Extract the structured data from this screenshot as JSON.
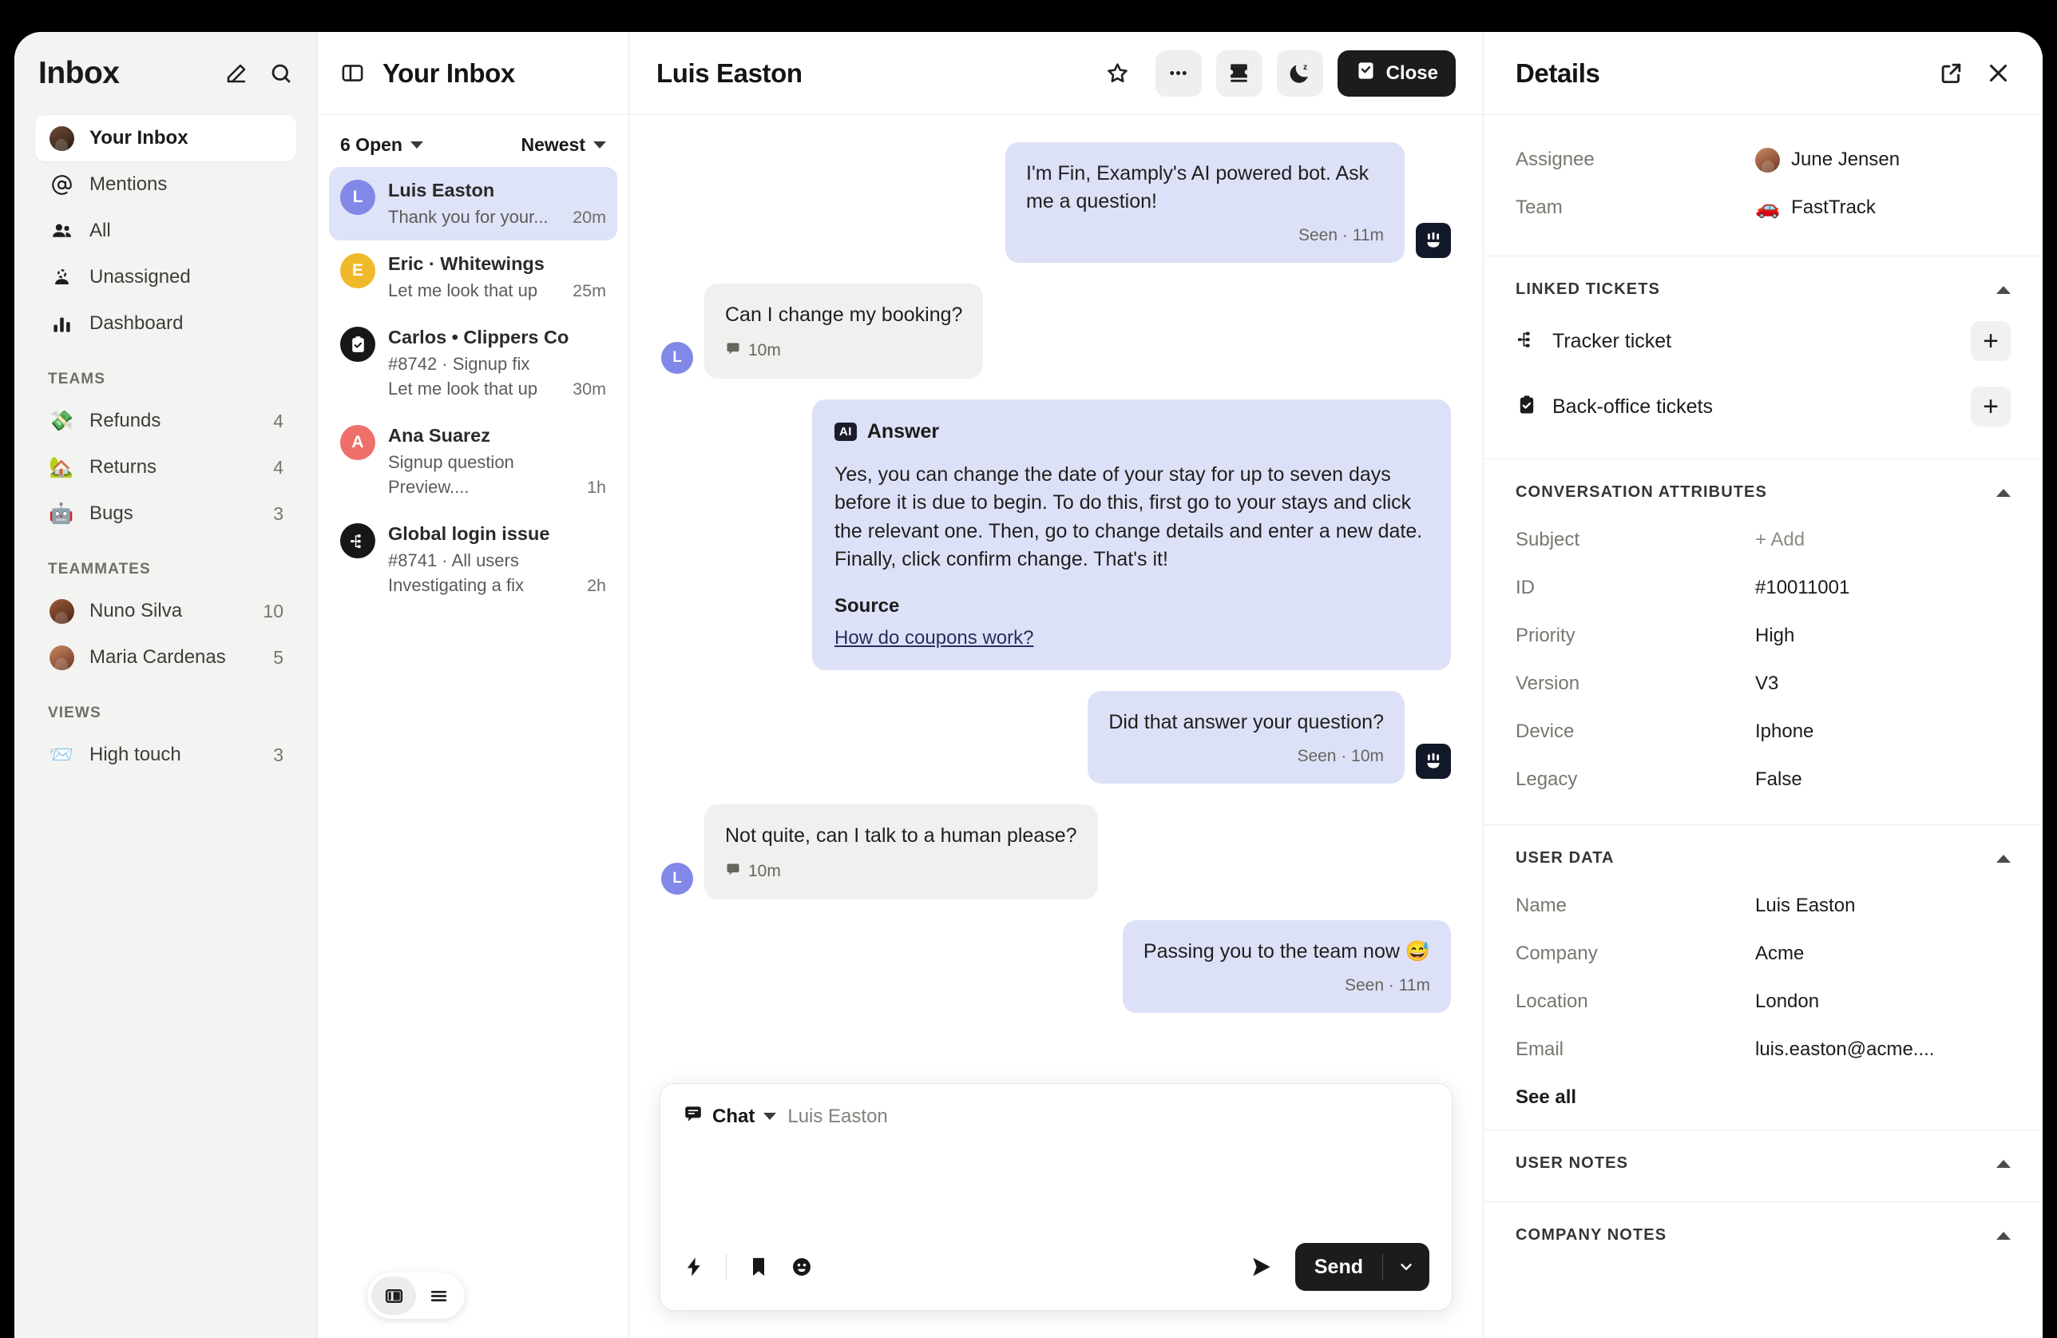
{
  "nav": {
    "title": "Inbox",
    "icons": {
      "compose": "compose-icon",
      "search": "search-icon"
    },
    "items": [
      {
        "label": "Your Inbox",
        "icon": "avatar",
        "active": true
      },
      {
        "label": "Mentions",
        "icon": "at-sign-icon"
      },
      {
        "label": "All",
        "icon": "people-icon"
      },
      {
        "label": "Unassigned",
        "icon": "unassigned-icon"
      },
      {
        "label": "Dashboard",
        "icon": "bar-chart-icon"
      }
    ],
    "teams_title": "TEAMS",
    "teams": [
      {
        "label": "Refunds",
        "emoji": "💸",
        "count": "4"
      },
      {
        "label": "Returns",
        "emoji": "🏡",
        "count": "4"
      },
      {
        "label": "Bugs",
        "emoji": "🤖",
        "count": "3"
      }
    ],
    "teammates_title": "TEAMMATES",
    "teammates": [
      {
        "label": "Nuno Silva",
        "count": "10"
      },
      {
        "label": "Maria Cardenas",
        "count": "5"
      }
    ],
    "views_title": "VIEWS",
    "views": [
      {
        "label": "High touch",
        "emoji": "📨",
        "count": "3"
      }
    ]
  },
  "conversation_list": {
    "header_title": "Your Inbox",
    "panel_icon": "panel-layout-icon",
    "filter": "6 Open",
    "sort": "Newest",
    "items": [
      {
        "name": "Luis Easton",
        "avatar_letter": "L",
        "avatar_color": "#8288e8",
        "meta": "",
        "preview": "Thank you for your...",
        "time": "20m",
        "selected": true
      },
      {
        "name": "Eric · Whitewings",
        "avatar_letter": "E",
        "avatar_color": "#f0b92a",
        "meta": "",
        "preview": "Let me look that up",
        "time": "25m",
        "selected": false
      },
      {
        "name": "Carlos • Clippers Co",
        "avatar_letter": "",
        "avatar_color": "#1c1c1a",
        "avatar_icon": "clipboard-check-icon",
        "meta": "#8742  · Signup fix",
        "preview": "Let me look that up",
        "time": "30m",
        "selected": false
      },
      {
        "name": "Ana Suarez",
        "avatar_letter": "A",
        "avatar_color": "#ef6f6a",
        "meta": "Signup question",
        "preview": "Preview....",
        "time": "1h",
        "selected": false
      },
      {
        "name": "Global login issue",
        "avatar_letter": "",
        "avatar_color": "#1c1c1a",
        "avatar_icon": "tracker-ticket-icon",
        "meta": "#8741 · All users",
        "preview": "Investigating a fix",
        "time": "2h",
        "selected": false
      }
    ],
    "view_toggle": {
      "split": "split-view-icon",
      "list": "list-view-icon"
    }
  },
  "conversation": {
    "title": "Luis Easton",
    "actions": {
      "star": "star-icon",
      "more": "ellipsis-icon",
      "ticket": "ticket-icon",
      "snooze": "moon-snooze-icon",
      "close_label": "Close",
      "close_icon": "close-check-icon"
    },
    "messages": [
      {
        "side": "out",
        "type": "text",
        "text": "I'm Fin, Examply's AI powered bot. Ask me a question!",
        "status": "Seen · 11m",
        "avatar": "fin-bot-icon"
      },
      {
        "side": "in",
        "type": "text",
        "text": "Can I change my booking?",
        "status": "10m",
        "status_icon": "chat-icon",
        "avatar_letter": "L"
      },
      {
        "side": "out",
        "type": "answer",
        "badge": "AI",
        "title": "Answer",
        "text": "Yes, you can change the date of your stay for up to seven days before it is due to begin. To do this, first go to your stays and click the relevant one. Then, go to change details and enter a new date. Finally, click confirm change. That's it!",
        "source_label": "Source",
        "source_link": "How do coupons work?"
      },
      {
        "side": "out",
        "type": "text",
        "text": "Did that answer your question?",
        "status": "Seen · 10m",
        "avatar": "fin-bot-icon"
      },
      {
        "side": "in",
        "type": "text",
        "text": "Not quite, can I talk to a human please?",
        "status": "10m",
        "status_icon": "chat-icon",
        "avatar_letter": "L"
      },
      {
        "side": "out",
        "type": "text",
        "text": "Passing you to the team now 😅",
        "status": "Seen · 11m"
      }
    ],
    "composer": {
      "channel": "Chat",
      "recipient": "Luis Easton",
      "placeholder": "",
      "value": "",
      "tools": [
        "lightning-icon",
        "saved-reply-icon",
        "emoji-icon"
      ],
      "send_label": "Send",
      "send_icon": "send-arrow-icon"
    }
  },
  "details": {
    "title": "Details",
    "open_icon": "open-external-icon",
    "close_icon": "close-x-icon",
    "top_fields": [
      {
        "key": "Assignee",
        "value": "June Jensen",
        "avatar": true
      },
      {
        "key": "Team",
        "value": "FastTrack",
        "emoji": "🚗"
      }
    ],
    "linked_tickets": {
      "title": "LINKED TICKETS",
      "rows": [
        {
          "label": "Tracker ticket",
          "icon": "tracker-ticket-icon",
          "action": "+"
        },
        {
          "label": "Back-office tickets",
          "icon": "clipboard-check-icon",
          "action": "+"
        }
      ]
    },
    "conversation_attributes": {
      "title": "CONVERSATION ATTRIBUTES",
      "rows": [
        {
          "key": "Subject",
          "value": "+ Add",
          "muted": true
        },
        {
          "key": "ID",
          "value": "#10011001"
        },
        {
          "key": "Priority",
          "value": "High"
        },
        {
          "key": "Version",
          "value": "V3"
        },
        {
          "key": "Device",
          "value": "Iphone"
        },
        {
          "key": "Legacy",
          "value": "False"
        }
      ]
    },
    "user_data": {
      "title": "USER DATA",
      "rows": [
        {
          "key": "Name",
          "value": "Luis Easton"
        },
        {
          "key": "Company",
          "value": "Acme"
        },
        {
          "key": "Location",
          "value": "London"
        },
        {
          "key": "Email",
          "value": "luis.easton@acme...."
        }
      ],
      "see_all": "See all"
    },
    "user_notes": {
      "title": "USER NOTES"
    },
    "company_notes": {
      "title": "COMPANY NOTES"
    }
  }
}
